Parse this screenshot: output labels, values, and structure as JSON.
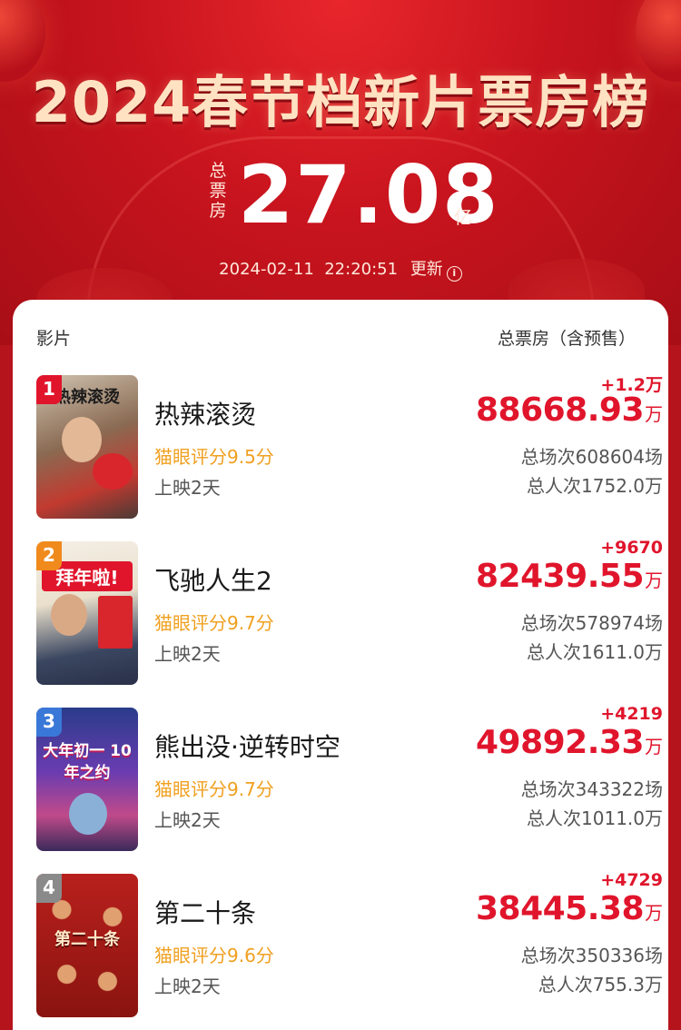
{
  "header": {
    "title": "2024春节档新片票房榜",
    "total_label": "总票房",
    "total_value": "27.08",
    "total_unit": "亿",
    "timestamp": "2024-02-11  22:20:51",
    "update_label": "更新",
    "info_icon": "info-icon"
  },
  "list": {
    "col_left": "影片",
    "col_right": "总票房（含预售）",
    "movies": [
      {
        "rank": "1",
        "title": "热辣滚烫",
        "rating": "猫眼评分9.5分",
        "days": "上映2天",
        "delta": "+1.2万",
        "box": "88668.93",
        "box_unit": "万",
        "shows": "总场次608604场",
        "people": "总人次1752.0万",
        "poster_text": "热辣滚烫",
        "badge_color": "#e0152c"
      },
      {
        "rank": "2",
        "title": "飞驰人生2",
        "rating": "猫眼评分9.7分",
        "days": "上映2天",
        "delta": "+9670",
        "box": "82439.55",
        "box_unit": "万",
        "shows": "总场次578974场",
        "people": "总人次1611.0万",
        "poster_text": "拜年啦!",
        "badge_color": "#f08a1c"
      },
      {
        "rank": "3",
        "title": "熊出没·逆转时空",
        "rating": "猫眼评分9.7分",
        "days": "上映2天",
        "delta": "+4219",
        "box": "49892.33",
        "box_unit": "万",
        "shows": "总场次343322场",
        "people": "总人次1011.0万",
        "poster_text": "大年初一 10年之约",
        "badge_color": "#3a78d8"
      },
      {
        "rank": "4",
        "title": "第二十条",
        "rating": "猫眼评分9.6分",
        "days": "上映2天",
        "delta": "+4729",
        "box": "38445.38",
        "box_unit": "万",
        "shows": "总场次350336场",
        "people": "总人次755.3万",
        "poster_text": "第二十条",
        "badge_color": "#8a8a8a"
      }
    ]
  }
}
